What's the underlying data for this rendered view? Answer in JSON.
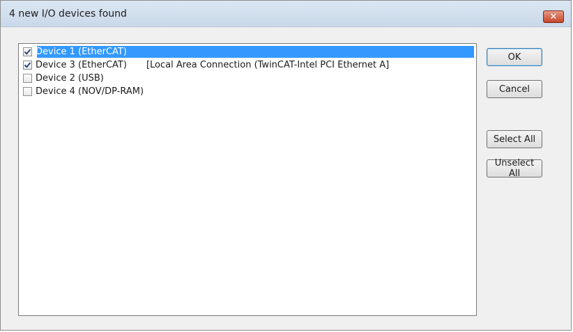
{
  "window": {
    "title": "4 new I/O devices found",
    "close_glyph": "✕"
  },
  "devices": [
    {
      "label": "Device 1 (EtherCAT)",
      "extra": "",
      "checked": true,
      "selected": true
    },
    {
      "label": "Device 3 (EtherCAT)",
      "extra": "[Local Area Connection (TwinCAT-Intel PCI Ethernet A]",
      "checked": true,
      "selected": false
    },
    {
      "label": "Device 2 (USB)",
      "extra": "",
      "checked": false,
      "selected": false
    },
    {
      "label": "Device 4 (NOV/DP-RAM)",
      "extra": "",
      "checked": false,
      "selected": false
    }
  ],
  "buttons": {
    "ok": "OK",
    "cancel": "Cancel",
    "select_all": "Select All",
    "unselect_all": "Unselect All"
  },
  "colors": {
    "selection": "#3399ff",
    "close_button": "#c7452a"
  }
}
